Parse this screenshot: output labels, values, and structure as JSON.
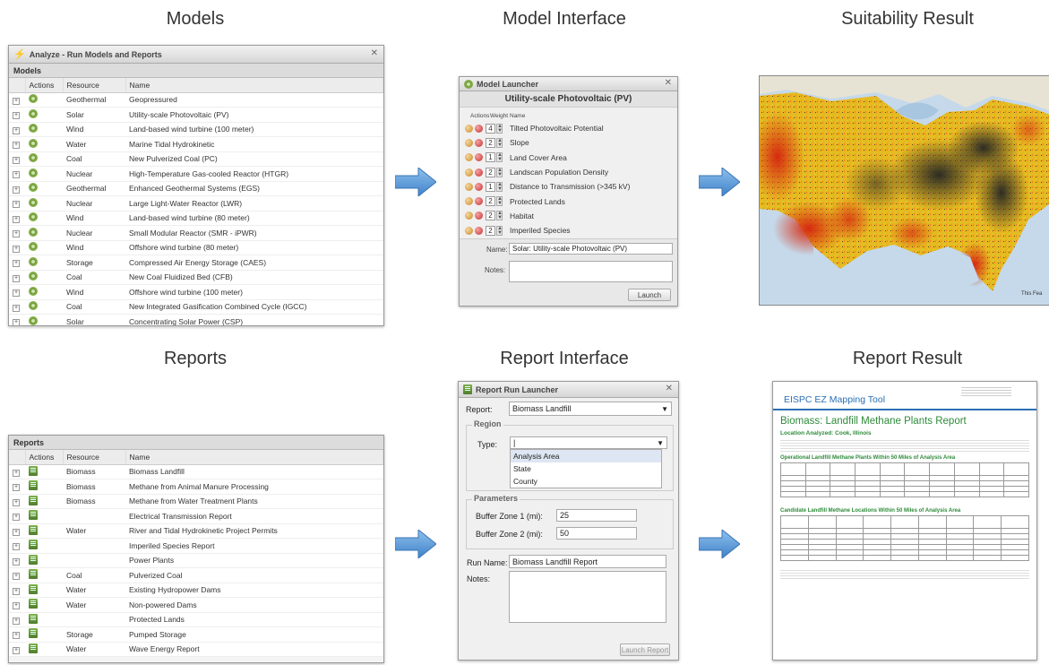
{
  "titles": {
    "models": "Models",
    "model_interface": "Model Interface",
    "suitability_result": "Suitability Result",
    "reports": "Reports",
    "report_interface": "Report Interface",
    "report_result": "Report Result"
  },
  "models_window": {
    "title": "Analyze - Run Models and Reports",
    "section": "Models",
    "columns": [
      "Actions",
      "Resource",
      "Name"
    ],
    "rows": [
      {
        "resource": "Geothermal",
        "name": "Geopressured"
      },
      {
        "resource": "Solar",
        "name": "Utility-scale Photovoltaic (PV)"
      },
      {
        "resource": "Wind",
        "name": "Land-based wind turbine (100 meter)"
      },
      {
        "resource": "Water",
        "name": "Marine Tidal Hydrokinetic"
      },
      {
        "resource": "Coal",
        "name": "New Pulverized Coal (PC)"
      },
      {
        "resource": "Nuclear",
        "name": "High-Temperature Gas-cooled Reactor (HTGR)"
      },
      {
        "resource": "Geothermal",
        "name": "Enhanced Geothermal Systems (EGS)"
      },
      {
        "resource": "Nuclear",
        "name": "Large Light-Water Reactor (LWR)"
      },
      {
        "resource": "Wind",
        "name": "Land-based wind turbine (80 meter)"
      },
      {
        "resource": "Nuclear",
        "name": "Small Modular Reactor (SMR - iPWR)"
      },
      {
        "resource": "Wind",
        "name": "Offshore wind turbine (80 meter)"
      },
      {
        "resource": "Storage",
        "name": "Compressed Air Energy Storage (CAES)"
      },
      {
        "resource": "Coal",
        "name": "New Coal Fluidized Bed (CFB)"
      },
      {
        "resource": "Wind",
        "name": "Offshore wind turbine (100 meter)"
      },
      {
        "resource": "Coal",
        "name": "New Integrated Gasification Combined Cycle (IGCC)"
      },
      {
        "resource": "Solar",
        "name": "Concentrating Solar Power (CSP)"
      }
    ]
  },
  "model_launcher": {
    "title": "Model Launcher",
    "heading": "Utility-scale Photovoltaic (PV)",
    "columns": [
      "Actions",
      "Weight",
      "Name"
    ],
    "rows": [
      {
        "weight": "4",
        "name": "Tilted Photovoltaic Potential"
      },
      {
        "weight": "2",
        "name": "Slope"
      },
      {
        "weight": "1",
        "name": "Land Cover Area"
      },
      {
        "weight": "2",
        "name": "Landscan Population Density"
      },
      {
        "weight": "1",
        "name": "Distance to Transmission (>345 kV)"
      },
      {
        "weight": "2",
        "name": "Protected Lands"
      },
      {
        "weight": "2",
        "name": "Habitat"
      },
      {
        "weight": "2",
        "name": "Imperiled Species"
      }
    ],
    "name_label": "Name:",
    "name_value": "Solar: Utility-scale Photovoltaic (PV)",
    "notes_label": "Notes:",
    "launch": "Launch"
  },
  "map": {
    "credit": "This Fea"
  },
  "reports_window": {
    "section": "Reports",
    "columns": [
      "Actions",
      "Resource",
      "Name"
    ],
    "rows": [
      {
        "resource": "Biomass",
        "name": "Biomass Landfill"
      },
      {
        "resource": "Biomass",
        "name": "Methane from Animal Manure Processing"
      },
      {
        "resource": "Biomass",
        "name": "Methane from Water Treatment Plants"
      },
      {
        "resource": "",
        "name": "Electrical Transmission Report"
      },
      {
        "resource": "Water",
        "name": "River and Tidal Hydrokinetic Project Permits"
      },
      {
        "resource": "",
        "name": "Imperiled Species Report"
      },
      {
        "resource": "",
        "name": "Power Plants"
      },
      {
        "resource": "Coal",
        "name": "Pulverized Coal"
      },
      {
        "resource": "Water",
        "name": "Existing Hydropower Dams"
      },
      {
        "resource": "Water",
        "name": "Non-powered Dams"
      },
      {
        "resource": "",
        "name": "Protected Lands"
      },
      {
        "resource": "Storage",
        "name": "Pumped Storage"
      },
      {
        "resource": "Water",
        "name": "Wave Energy Report"
      }
    ]
  },
  "report_launcher": {
    "title": "Report Run Launcher",
    "report_label": "Report:",
    "report_value": "Biomass Landfill",
    "region_legend": "Region",
    "type_label": "Type:",
    "type_value": "|",
    "type_options": [
      "Analysis Area",
      "State",
      "County"
    ],
    "params_legend": "Parameters",
    "buffer1_label": "Buffer Zone 1 (mi):",
    "buffer1_value": "25",
    "buffer2_label": "Buffer Zone 2 (mi):",
    "buffer2_value": "50",
    "run_name_label": "Run Name:",
    "run_name_value": "Biomass Landfill Report",
    "notes_label": "Notes:",
    "launch": "Launch Report"
  },
  "report_doc": {
    "brand": "EISPC EZ Mapping Tool",
    "title": "Biomass: Landfill Methane Plants Report",
    "location": "Location Analyzed: Cook, Illinois",
    "section1": "Operational Landfill Methane Plants Within 50 Miles of Analysis Area",
    "section2": "Candidate Landfill Methane Locations Within 50 Miles of Analysis Area"
  },
  "colors": {
    "arrow": "#5b9bd5",
    "accent": "#2e8b3a",
    "brand_blue": "#2a6fb5"
  }
}
